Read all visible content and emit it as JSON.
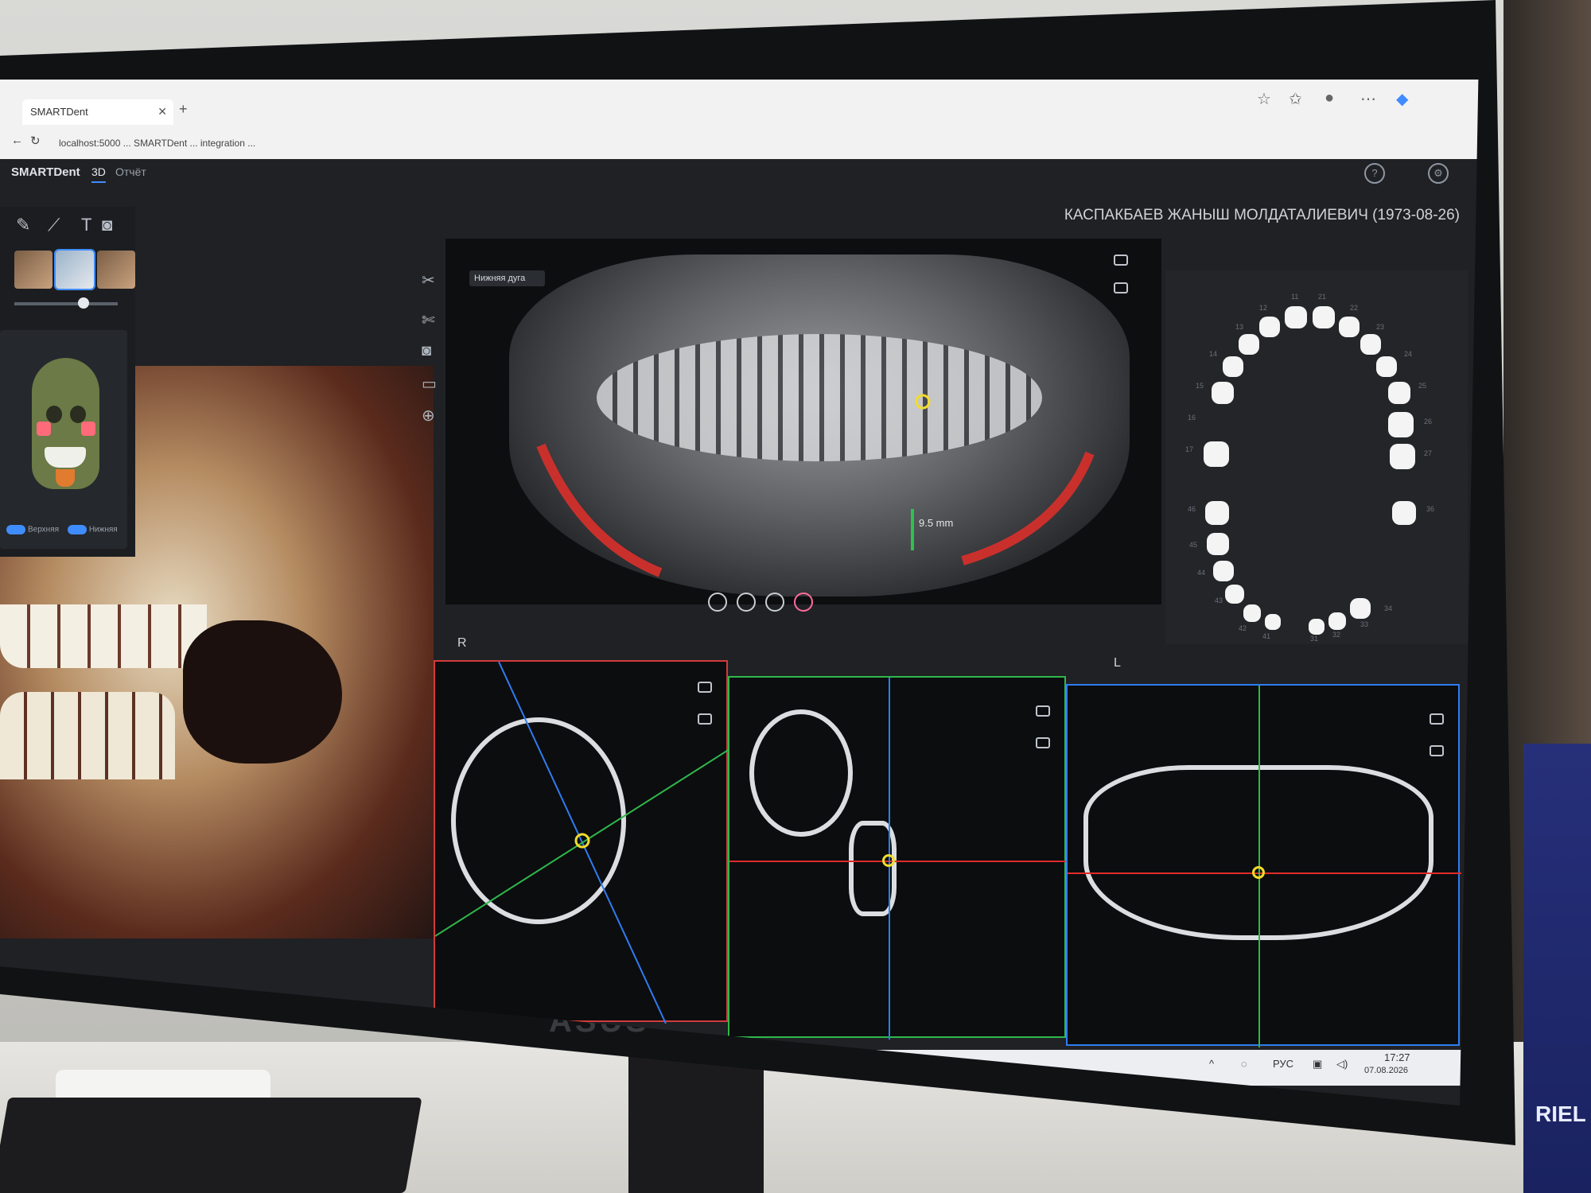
{
  "browser": {
    "tab_title": "SMARTDent",
    "url": "localhost:5000 ... SMARTDent ... integration ...",
    "icons": [
      "star-icon",
      "favorites-icon",
      "profile-icon",
      "more-icon",
      "copilot-icon"
    ]
  },
  "app": {
    "logo": "SMARTDent",
    "tabs": [
      {
        "label": "3D",
        "active": true
      },
      {
        "label": "Отчёт",
        "active": false
      }
    ],
    "patient_name": "КАСПАКБАЕВ ЖАНЫШ МОЛДАТАЛИЕВИЧ (1973-08-26)"
  },
  "left_panel": {
    "tools": [
      "pencil-icon",
      "brush-icon",
      "text-icon",
      "camera-icon"
    ],
    "toggles": [
      {
        "label": "Верхняя",
        "on": true
      },
      {
        "label": "Нижняя",
        "on": true
      }
    ],
    "skull_colors": {
      "skull": "#6b7a46",
      "highlight": "#ff6b7a",
      "chin": "#e07b2f"
    }
  },
  "panorama": {
    "layer_title": "Нижняя дуга",
    "measurement": "9.5 mm",
    "left_marker": "R",
    "right_marker": "L",
    "tools": [
      "filter-icon",
      "brightness-icon",
      "contrast-icon",
      "tooth-icon"
    ]
  },
  "tooth_chart": {
    "upper_numbers": [
      "11",
      "21",
      "12",
      "22",
      "13",
      "23",
      "14",
      "24",
      "15",
      "25",
      "16",
      "26",
      "17",
      "27"
    ],
    "lower_numbers": [
      "46",
      "36",
      "45",
      "44",
      "43",
      "42",
      "41",
      "31",
      "32",
      "33",
      "34"
    ]
  },
  "slices": {
    "axial_color": "#d23a3a",
    "coronal_color": "#2fb84b",
    "sagittal_color": "#2f7df0"
  },
  "taskbar": {
    "lang": "РУС",
    "time": "17:27",
    "date": "07.08.2026"
  },
  "monitor": {
    "brand": "ASUS"
  },
  "brochure": {
    "text": "RIEL"
  }
}
